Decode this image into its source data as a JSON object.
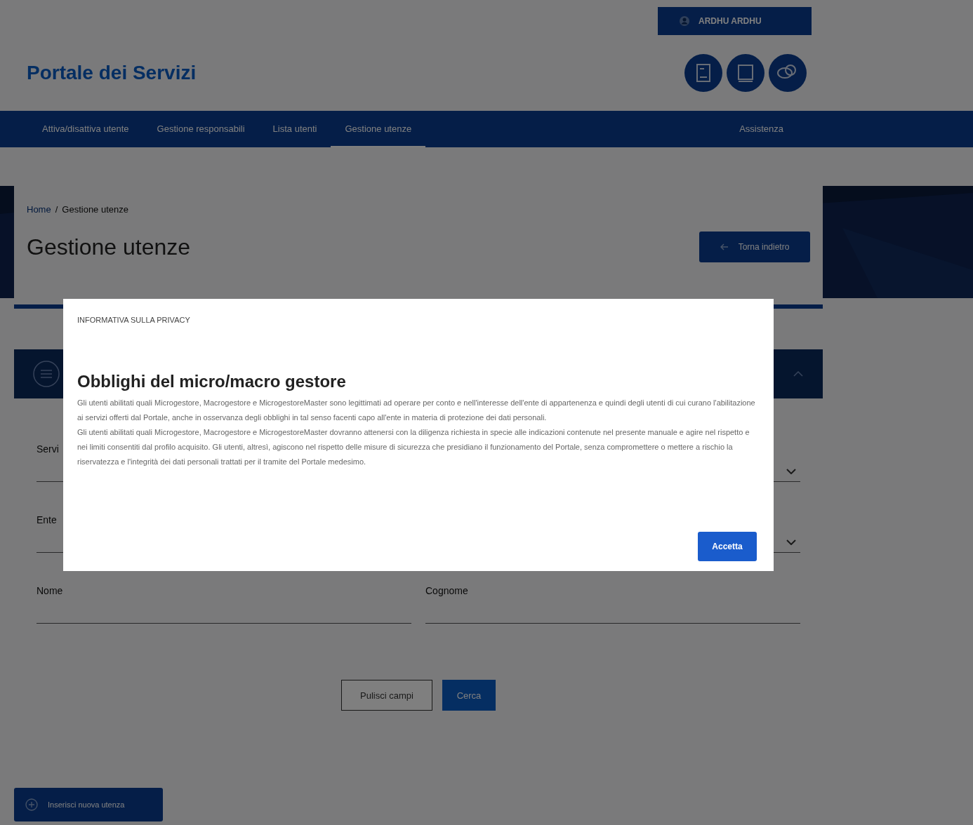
{
  "top_bar": {
    "user": "ARDHU ARDHU"
  },
  "header": {
    "title": "Portale dei Servizi"
  },
  "nav": {
    "items": [
      {
        "label": "Attiva/disattiva utente",
        "selected": false
      },
      {
        "label": "Gestione responsabili",
        "selected": false
      },
      {
        "label": "Lista utenti",
        "selected": false
      },
      {
        "label": "Gestione utenze",
        "selected": true
      }
    ],
    "assist": "Assistenza"
  },
  "breadcrumb": [
    "Home",
    "/",
    "Gestione utenze"
  ],
  "page_title": "Gestione utenze",
  "back_button": "Torna indietro",
  "form": {
    "fields": [
      {
        "label": "Servi",
        "kind": "select"
      },
      {
        "label": "Ente",
        "kind": "select"
      },
      {
        "label": "Nome",
        "kind": "text"
      },
      {
        "label": "Cognome",
        "kind": "text"
      }
    ],
    "buttons": [
      "Pulisci campi",
      "Cerca"
    ]
  },
  "add_button": "Inserisci nuova utenza",
  "modal": {
    "eyebrow": "INFORMATIVA SULLA PRIVACY",
    "title": "Obblighi del micro/macro gestore",
    "paragraphs": [
      "Gli utenti abilitati quali Microgestore, Macrogestore e MicrogestoreMaster sono legittimati ad operare per conto e nell'interesse dell'ente di appartenenza e quindi degli utenti di cui curano l'abilitazione ai servizi offerti dal Portale, anche in osservanza degli obblighi in tal senso facenti capo all'ente in materia di protezione dei dati personali.",
      "Gli utenti abilitati quali Microgestore, Macrogestore e MicrogestoreMaster dovranno attenersi con la diligenza richiesta in specie alle indicazioni contenute nel presente manuale e agire nel rispetto e nei limiti consentiti dal profilo acquisito. Gli utenti, altresì, agiscono nel rispetto delle misure di sicurezza che presidiano il funzionamento del Portale, senza compromettere o mettere a rischio la riservatezza e l'integrità dei dati personali trattati per il tramite del Portale medesimo."
    ],
    "button": "Accetta"
  }
}
